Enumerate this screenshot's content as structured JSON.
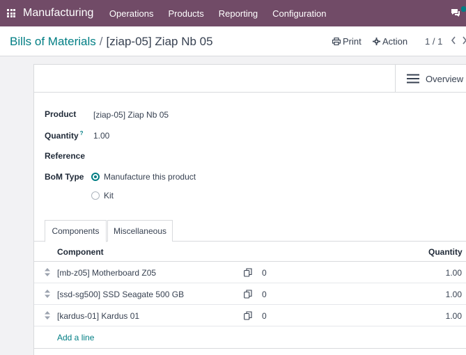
{
  "navbar": {
    "app_name": "Manufacturing",
    "menu": [
      "Operations",
      "Products",
      "Reporting",
      "Configuration"
    ],
    "bg_color": "#714B67"
  },
  "breadcrumb": {
    "parent": "Bills of Materials",
    "separator": "/",
    "current": "[ziap-05] Ziap Nb 05"
  },
  "toolbar": {
    "print_label": "Print",
    "action_label": "Action",
    "pager": "1 / 1"
  },
  "smart_buttons": {
    "overview_label": "Overview"
  },
  "form": {
    "product_label": "Product",
    "product_value": "[ziap-05] Ziap Nb 05",
    "quantity_label": "Quantity",
    "quantity_help": "?",
    "quantity_value": "1.00",
    "reference_label": "Reference",
    "reference_value": "",
    "bom_type_label": "BoM Type",
    "bom_type_options": [
      "Manufacture this product",
      "Kit"
    ],
    "bom_type_selected": "Manufacture this product"
  },
  "tabs": [
    "Components",
    "Miscellaneous"
  ],
  "active_tab": "Components",
  "table": {
    "headers": {
      "component": "Component",
      "quantity": "Quantity"
    },
    "rows": [
      {
        "component": "[mb-z05] Motherboard Z05",
        "count": "0",
        "quantity": "1.00"
      },
      {
        "component": "[ssd-sg500] SSD Seagate 500 GB",
        "count": "0",
        "quantity": "1.00"
      },
      {
        "component": "[kardus-01] Kardus 01",
        "count": "0",
        "quantity": "1.00"
      }
    ],
    "add_line": "Add a line"
  },
  "accent_color": "#017e84"
}
